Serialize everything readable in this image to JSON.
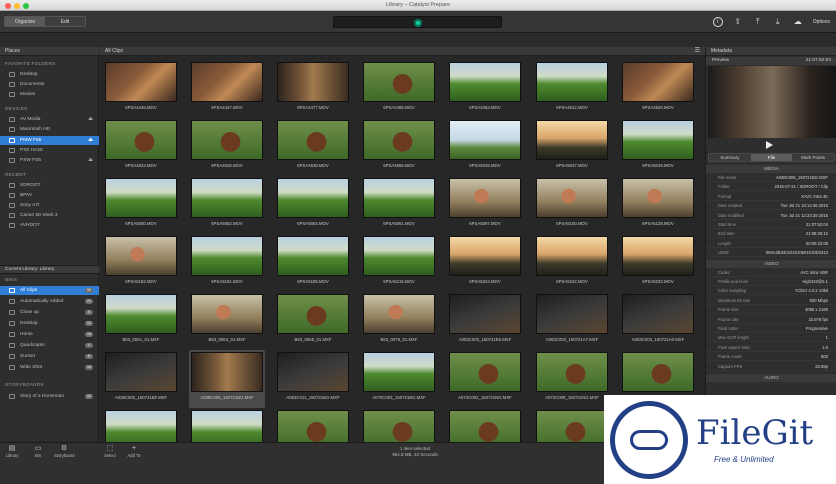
{
  "window": {
    "title": "Library – Catalyst Prepare"
  },
  "toolbar": {
    "modes": [
      {
        "label": "Organize",
        "active": true
      },
      {
        "label": "Edit",
        "active": false
      }
    ],
    "options_label": "Options"
  },
  "left": {
    "header": "Places",
    "favorites_title": "FAVORITE FOLDERS",
    "favorites": [
      "Desktop",
      "Documents",
      "Movies"
    ],
    "devices_title": "DEVICES",
    "devices": [
      "AV Media",
      "Macintosh HD",
      "PMW F55",
      "PXZ HA25",
      "PXW FS5"
    ],
    "recent_title": "RECENT",
    "recent": [
      "XDROOT",
      "BPAV",
      "Sony A7r",
      "Canon 5D Mark 3",
      "AVHDOT"
    ],
    "library_header": "Current Library: Library",
    "bins_title": "BINS",
    "bins": [
      {
        "label": "All Clips",
        "count": "56"
      },
      {
        "label": "Automatically Added",
        "count": "21"
      },
      {
        "label": "Close up",
        "count": "5"
      },
      {
        "label": "Desktop",
        "count": "12"
      },
      {
        "label": "Horse",
        "count": "18"
      },
      {
        "label": "Quadcopter",
        "count": "4"
      },
      {
        "label": "Sunset",
        "count": "6"
      },
      {
        "label": "Wide Shot",
        "count": "15"
      }
    ],
    "storyboards_title": "STORYBOARDS",
    "storyboards": [
      {
        "label": "Story of a Horseman",
        "count": "12"
      }
    ]
  },
  "grid": {
    "header": "All Clips",
    "clips": [
      {
        "name": "6PSA4446.MOV",
        "g": "g-barn"
      },
      {
        "name": "6PSA4447.MOV",
        "g": "g-barn"
      },
      {
        "name": "6PSA4477.MOV",
        "g": "g-stable"
      },
      {
        "name": "6PSA4485.MOV",
        "g": "g-horse"
      },
      {
        "name": "6PSA4453.MOV",
        "g": "g-field"
      },
      {
        "name": "6PSA4512.MOV",
        "g": "g-field"
      },
      {
        "name": "6PSA4520.MOV",
        "g": "g-barn"
      },
      {
        "name": "6PSA4623.MOV",
        "g": "g-horse"
      },
      {
        "name": "6PSA4626.MOV",
        "g": "g-horse"
      },
      {
        "name": "6PSA4638.MOV",
        "g": "g-horse"
      },
      {
        "name": "6PSA4656.MOV",
        "g": "g-horse"
      },
      {
        "name": "6PSA5045.MOV",
        "g": "g-sky"
      },
      {
        "name": "6PSA5047.MOV",
        "g": "g-sunset"
      },
      {
        "name": "6PSA5049.MOV",
        "g": "g-field"
      },
      {
        "name": "6PSA5050.MOV",
        "g": "g-field"
      },
      {
        "name": "6PSA5052.MOV",
        "g": "g-field"
      },
      {
        "name": "6PSA5054.MOV",
        "g": "g-field"
      },
      {
        "name": "6PSA5061.MOV",
        "g": "g-field"
      },
      {
        "name": "6PSA5097.MOV",
        "g": "g-cow"
      },
      {
        "name": "6PSA5100.MOV",
        "g": "g-cow"
      },
      {
        "name": "6PSA5128.MOV",
        "g": "g-cow"
      },
      {
        "name": "6PSA5162.MOV",
        "g": "g-cow"
      },
      {
        "name": "6PSA5191.MOV",
        "g": "g-field"
      },
      {
        "name": "6PSA5195.MOV",
        "g": "g-field"
      },
      {
        "name": "6PSA5215.MOV",
        "g": "g-field"
      },
      {
        "name": "6PSA5224.MOV",
        "g": "g-sunset"
      },
      {
        "name": "6PSA5232.MOV",
        "g": "g-sunset"
      },
      {
        "name": "6PSA5233.MOV",
        "g": "g-sunset"
      },
      {
        "name": "B63_0061_01.MXF",
        "g": "g-field"
      },
      {
        "name": "B63_0064_01.MXF",
        "g": "g-cow"
      },
      {
        "name": "B63_0068_01.MXF",
        "g": "g-horse"
      },
      {
        "name": "B63_0078_01.MXF",
        "g": "g-cow"
      },
      {
        "name": "A003C003_150721E6.MXF",
        "g": "g-dark"
      },
      {
        "name": "A003C002_150721A7.MXF",
        "g": "g-dark"
      },
      {
        "name": "A003C003_150721A0.MXF",
        "g": "g-dark"
      },
      {
        "name": "A038C002_150721BF.MXF",
        "g": "g-dark",
        "selected": false
      },
      {
        "name": "A038C006_150721BG.MXF",
        "g": "g-stable",
        "selected": true
      },
      {
        "name": "A063C011_150721BO.MXF",
        "g": "g-dark"
      },
      {
        "name": "A070C003_150721BG.MXF",
        "g": "g-field"
      },
      {
        "name": "A072C002_150721NG.MXF",
        "g": "g-horse"
      },
      {
        "name": "A072C008_150721NG.MXF",
        "g": "g-horse"
      },
      {
        "name": "A072C004_150721NG.MXF",
        "g": "g-horse"
      },
      {
        "name": "",
        "g": "g-field"
      },
      {
        "name": "",
        "g": "g-field"
      },
      {
        "name": "",
        "g": "g-horse"
      },
      {
        "name": "",
        "g": "g-horse"
      },
      {
        "name": "",
        "g": "g-horse"
      },
      {
        "name": "",
        "g": "g-horse"
      },
      {
        "name": "",
        "g": "g-field"
      }
    ]
  },
  "right": {
    "header": "Metadata",
    "preview_label": "Preview",
    "timecode": "21:07:52:04",
    "tabs": [
      {
        "label": "Summary",
        "active": false
      },
      {
        "label": "File",
        "active": true
      },
      {
        "label": "Mark Points",
        "active": false
      }
    ],
    "media_title": "MEDIA",
    "media": [
      {
        "k": "File name",
        "v": "A038C006_150721BG.MXF"
      },
      {
        "k": "Folder",
        "v": "2015-07-21 / XDROOT / Clip"
      },
      {
        "k": "Format",
        "v": "XAVC Intra 4K"
      },
      {
        "k": "Date created",
        "v": "Tue Jul 21 13:14:36 2015"
      },
      {
        "k": "Date modified",
        "v": "Tue Jul 21 12:23:28 2015"
      },
      {
        "k": "Start time",
        "v": "21:07:52:04"
      },
      {
        "k": "End time",
        "v": "21:08:25:12"
      },
      {
        "k": "Length",
        "v": "00:00:33:08"
      },
      {
        "k": "UMID",
        "v": "060A2B340101010501010D4313"
      }
    ],
    "video_title": "VIDEO",
    "video": [
      {
        "k": "Codec",
        "v": "AVC Intra VBR"
      },
      {
        "k": "Profile and level",
        "v": "High422@5.1"
      },
      {
        "k": "Color sampling",
        "v": "YCbCr 4:2:2 10bit"
      },
      {
        "k": "Maximum bit rate",
        "v": "600 Mbps"
      },
      {
        "k": "Frame size",
        "v": "4096 x 2160"
      },
      {
        "k": "Frame rate",
        "v": "23.976 fps"
      },
      {
        "k": "Field order",
        "v": "Progressive"
      },
      {
        "k": "Max GOP length",
        "v": "1"
      },
      {
        "k": "Pixel aspect ratio",
        "v": "1.0"
      },
      {
        "k": "Frame count",
        "v": "800"
      },
      {
        "k": "Capture FPS",
        "v": "23.98p"
      }
    ],
    "audio_title": "AUDIO"
  },
  "bottom": {
    "buttons": [
      "Library",
      "Bin",
      "Storyboard",
      "Select",
      "Add To"
    ],
    "status_line1": "1 item selected",
    "status_line2": "954.8 MB, 33 Seconds"
  },
  "watermark": {
    "brand": "FileGit",
    "tagline": "Free & Unlimited"
  }
}
